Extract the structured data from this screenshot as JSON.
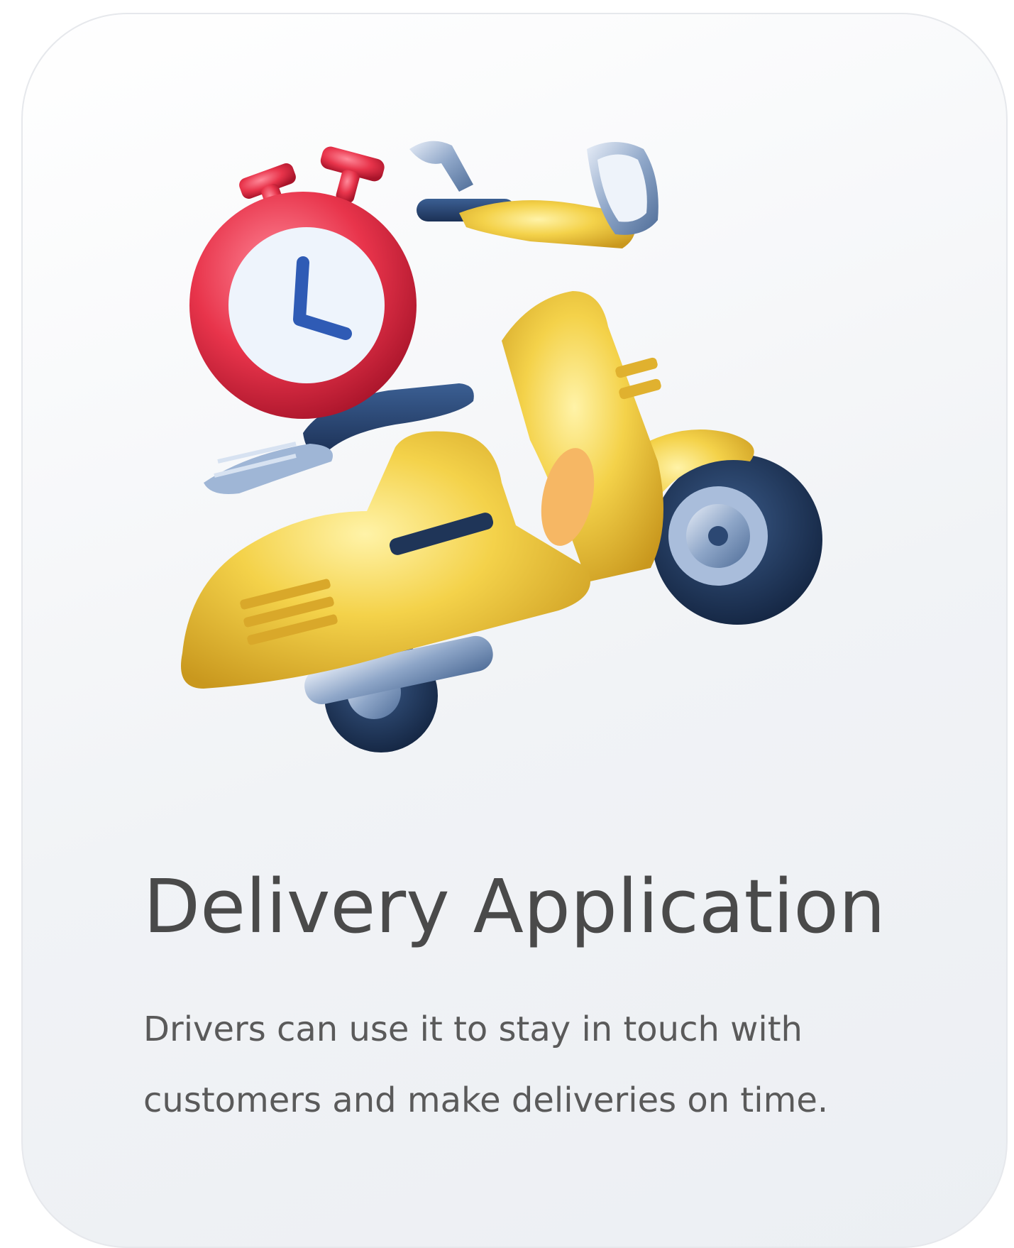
{
  "card": {
    "title": "Delivery Application",
    "description": "Drivers can use it to stay in touch with customers and make deliveries on time.",
    "illustration": {
      "icon": "scooter-with-stopwatch-icon",
      "colors": {
        "scooter_body": "#f0c93a",
        "stopwatch_ring": "#e8344b",
        "tires": "#1f3558",
        "metal": "#8ea6c8"
      }
    }
  }
}
